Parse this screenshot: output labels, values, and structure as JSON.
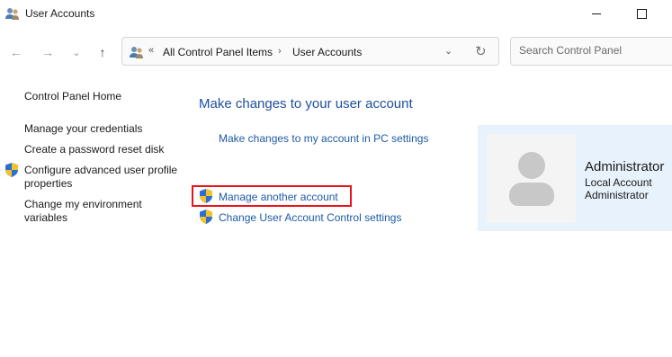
{
  "window": {
    "title": "User Accounts",
    "title_icon": "users-icon"
  },
  "nav": {
    "back_icon": "←",
    "forward_icon": "→",
    "recent_icon": "⌄",
    "up_icon": "↑",
    "breadcrumb": [
      "All Control Panel Items",
      "User Accounts"
    ],
    "breadcrumb_prefix": "«",
    "separator": "›",
    "dropdown_icon": "⌄",
    "refresh_icon": "↻",
    "search_placeholder": "Search Control Panel"
  },
  "sidebar": {
    "home": "Control Panel Home",
    "items": [
      {
        "label": "Manage your credentials",
        "shield": false
      },
      {
        "label": "Create a password reset disk",
        "shield": false
      },
      {
        "label": "Configure advanced user profile properties",
        "shield": true
      },
      {
        "label": "Change my environment variables",
        "shield": false
      }
    ]
  },
  "main": {
    "title": "Make changes to your user account",
    "links": {
      "pc_settings": "Make changes to my account in PC settings",
      "manage_another": "Manage another account",
      "uac": "Change User Account Control settings"
    }
  },
  "account": {
    "name": "Administrator",
    "type": "Local Account",
    "role": "Administrator"
  },
  "colors": {
    "link_blue": "#1e5aa8",
    "title_blue": "#1e4fa0",
    "highlight_red": "#e8141c",
    "panel_bg": "#e8f2fc"
  }
}
